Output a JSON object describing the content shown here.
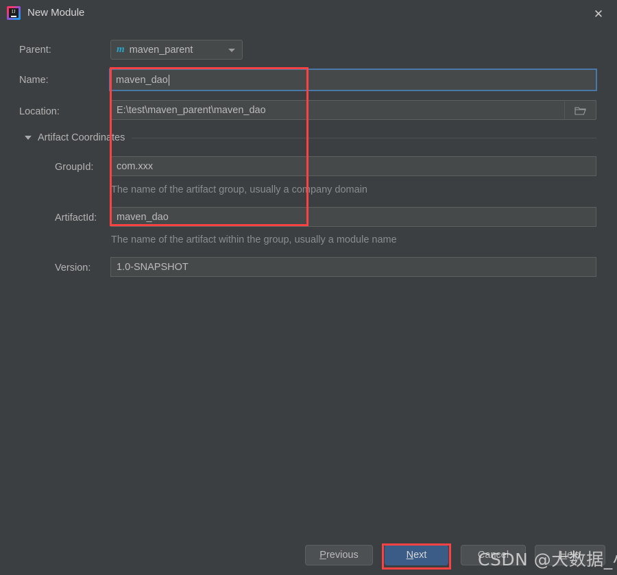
{
  "window": {
    "title": "New Module",
    "app_icon": "intellij-idea-icon",
    "close_icon": "close-icon"
  },
  "form": {
    "parent": {
      "label": "Parent:",
      "value": "maven_parent",
      "icon": "maven-module-icon",
      "dropdown_icon": "chevron-down-icon"
    },
    "name": {
      "label": "Name:",
      "value": "maven_dao",
      "focused": true
    },
    "location": {
      "label": "Location:",
      "value": "E:\\test\\maven_parent\\maven_dao",
      "browse_icon": "folder-icon"
    },
    "artifact_coordinates": {
      "label": "Artifact Coordinates",
      "expand_icon": "triangle-down-icon",
      "group_id": {
        "label": "GroupId:",
        "value": "com.xxx",
        "hint": "The name of the artifact group, usually a company domain"
      },
      "artifact_id": {
        "label": "ArtifactId:",
        "value": "maven_dao",
        "hint": "The name of the artifact within the group, usually a module name"
      }
    },
    "version": {
      "label": "Version:",
      "value": "1.0-SNAPSHOT"
    }
  },
  "footer": {
    "previous": {
      "prefix": "P",
      "rest": "revious"
    },
    "next": {
      "prefix": "N",
      "rest": "ext"
    },
    "cancel": "Cancel",
    "help": {
      "prefix": "H",
      "rest": "elp"
    }
  },
  "annotations": {
    "accent_color": "#fc4242",
    "focus_color": "#4a78a8",
    "primary_button_color": "#3c5c88"
  },
  "watermark": "CSDN @大数据_小袁"
}
